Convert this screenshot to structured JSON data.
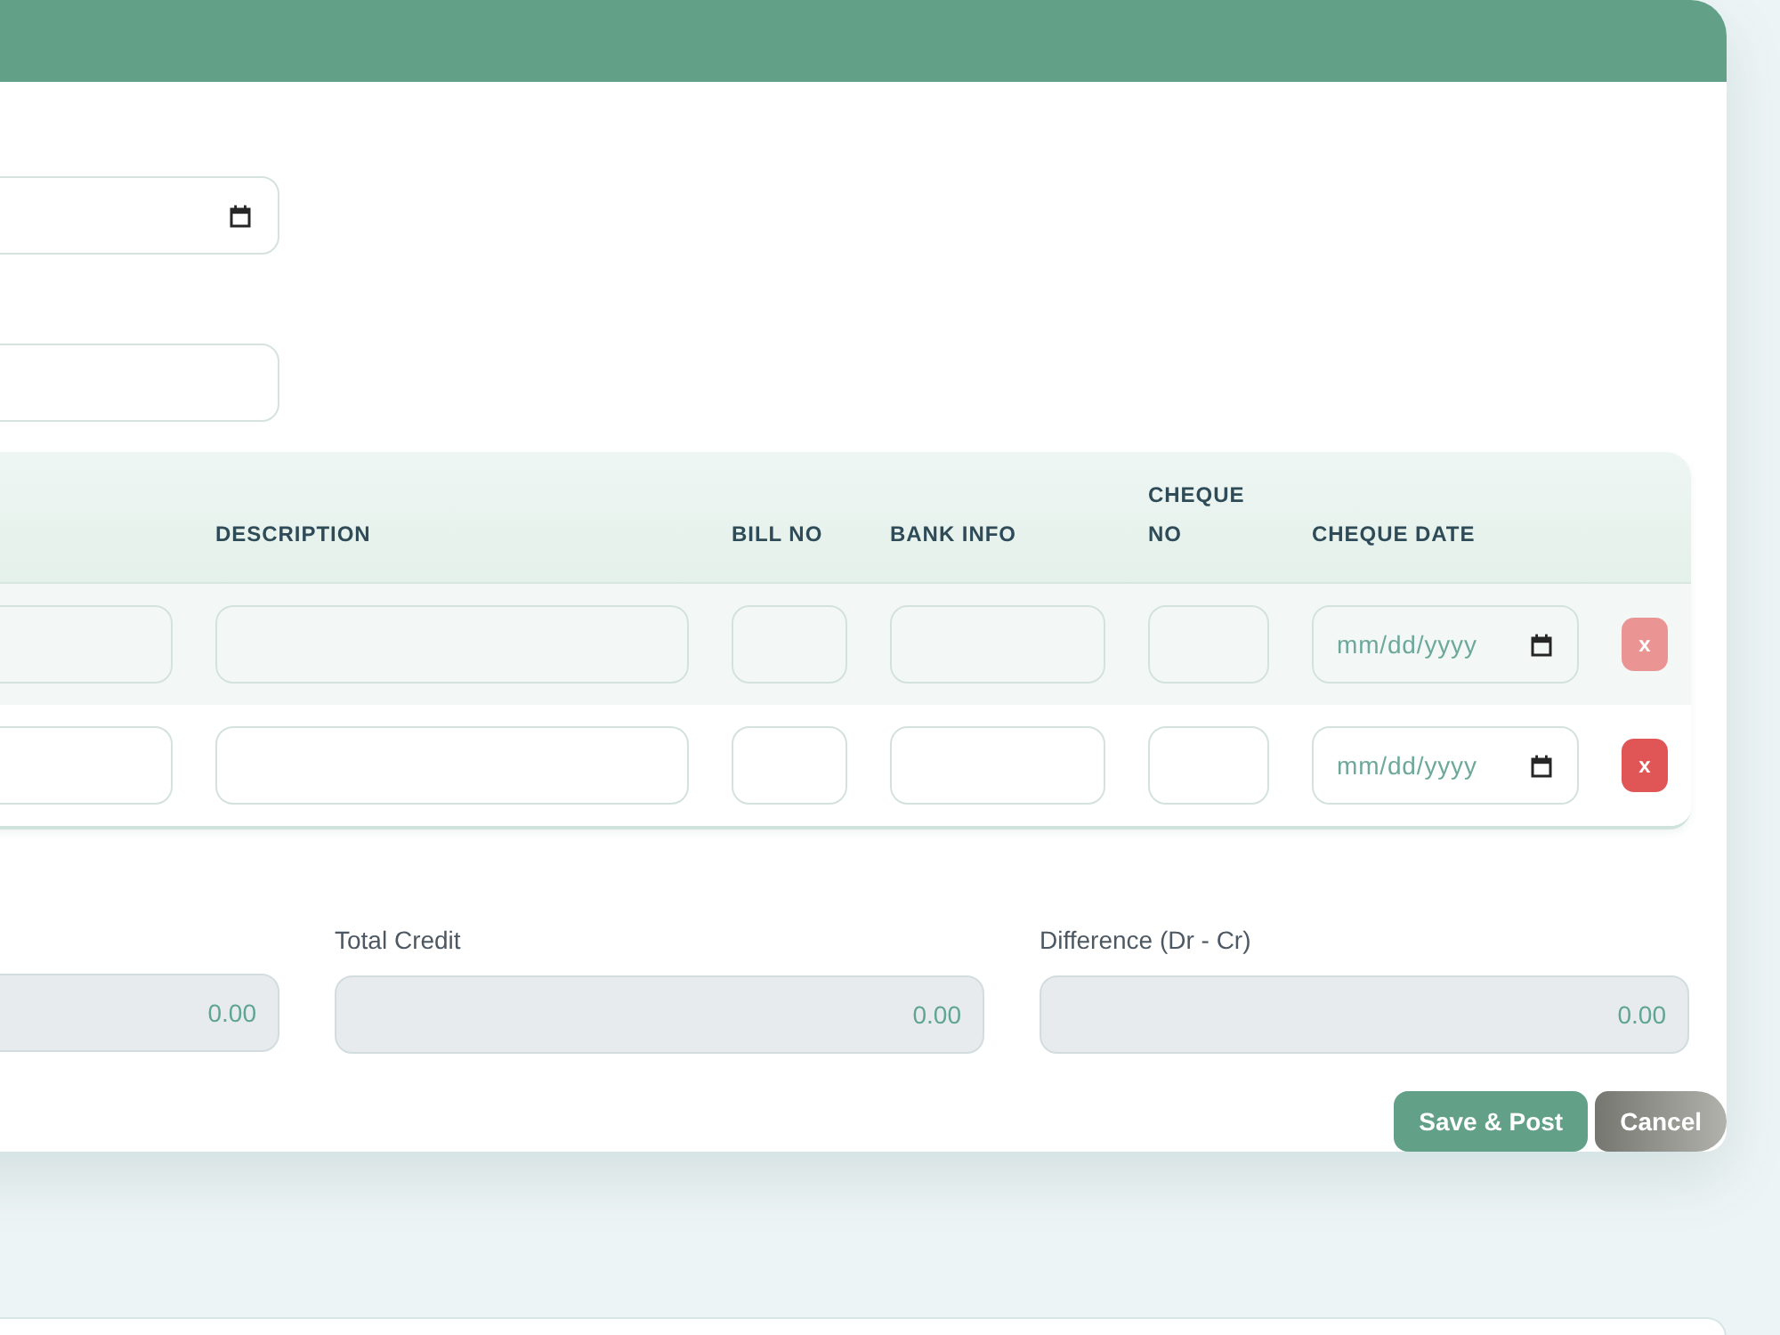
{
  "form_fields": [
    {
      "kind": "date"
    },
    {
      "kind": "text"
    }
  ],
  "table": {
    "columns": [
      {
        "label": "DESCRIPTION"
      },
      {
        "label": "BILL NO"
      },
      {
        "label": "BANK INFO"
      },
      {
        "label": "CHEQUE NO"
      },
      {
        "label": "CHEQUE DATE"
      }
    ],
    "rows": [
      {
        "cheque_date": {
          "placeholder": "mm/dd/yyyy"
        },
        "remove": {
          "label": "x",
          "disabled": true
        }
      },
      {
        "cheque_date": {
          "placeholder": "mm/dd/yyyy"
        },
        "remove": {
          "label": "x",
          "disabled": false
        }
      }
    ]
  },
  "totals": [
    {
      "value": "0.00"
    },
    {
      "label": "Total Credit",
      "value": "0.00"
    },
    {
      "label": "Difference (Dr - Cr)",
      "value": "0.00"
    }
  ],
  "actions": [
    {
      "label": "Save & Post",
      "kind": "primary"
    },
    {
      "label": "Cancel",
      "kind": "secondary"
    }
  ]
}
